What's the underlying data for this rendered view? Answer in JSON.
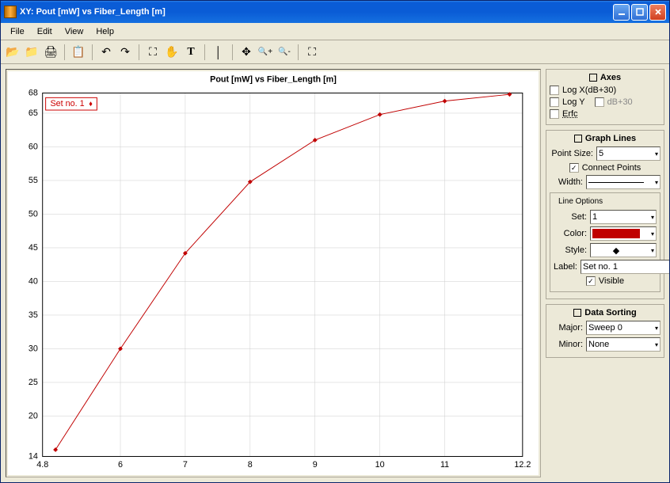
{
  "window": {
    "title": "XY: Pout [mW] vs Fiber_Length [m]"
  },
  "menus": {
    "file": "File",
    "edit": "Edit",
    "view": "View",
    "help": "Help"
  },
  "toolbar": {
    "open": "open",
    "new": "new",
    "print": "print",
    "copy": "copy",
    "undo": "undo",
    "redo": "redo",
    "zoom": "zoom",
    "pan": "pan",
    "text": "text",
    "divider": "divider",
    "move": "move",
    "zoomin": "zoomin",
    "zoomout": "zoomout",
    "fit": "fit"
  },
  "axes": {
    "title": "Axes",
    "logx_label": "Log X(dB+30)",
    "logx_checked": false,
    "logy_label": "Log Y",
    "logy_checked": false,
    "db30_label": "dB+30",
    "db30_enabled": false,
    "erfc_label": "Erfc",
    "erfc_checked": false
  },
  "graphlines": {
    "title": "Graph Lines",
    "pointsize_label": "Point Size:",
    "pointsize_value": "5",
    "connect_label": "Connect Points",
    "connect_checked": true,
    "width_label": "Width:",
    "lineoptions_label": "Line Options",
    "set_label": "Set:",
    "set_value": "1",
    "color_label": "Color:",
    "color_value": "#c00000",
    "style_label": "Style:",
    "label_label": "Label:",
    "label_value": "Set no. 1",
    "visible_label": "Visible",
    "visible_checked": true
  },
  "datasort": {
    "title": "Data Sorting",
    "major_label": "Major:",
    "major_value": "Sweep 0",
    "minor_label": "Minor:",
    "minor_value": "None"
  },
  "chart_data": {
    "type": "line",
    "title": "Pout [mW] vs Fiber_Length [m]",
    "xlabel": "",
    "ylabel": "",
    "xlim": [
      4.8,
      12.2
    ],
    "ylim": [
      14,
      68
    ],
    "x_ticks": [
      4.8,
      6,
      7,
      8,
      9,
      10,
      11,
      12.2
    ],
    "y_ticks": [
      14,
      20,
      25,
      30,
      35,
      40,
      45,
      50,
      55,
      60,
      65,
      68
    ],
    "legend": {
      "position": "top-left",
      "entries": [
        "Set no. 1"
      ]
    },
    "series": [
      {
        "name": "Set no. 1",
        "color": "#c00000",
        "x": [
          5,
          6,
          7,
          8,
          9,
          10,
          11,
          12
        ],
        "values": [
          15,
          30,
          44.2,
          54.8,
          61,
          64.8,
          66.8,
          67.8
        ]
      }
    ]
  }
}
